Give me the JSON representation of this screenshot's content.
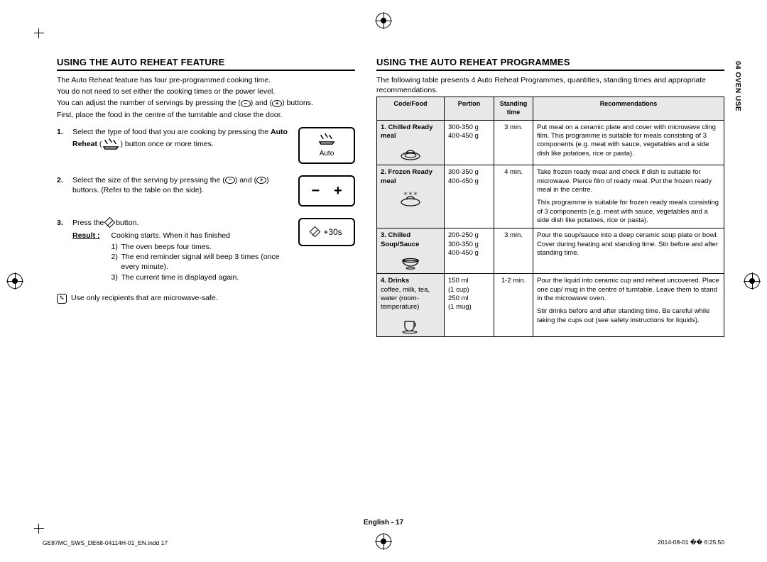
{
  "side_tab": "04  OVEN USE",
  "left": {
    "heading": "USING THE AUTO REHEAT FEATURE",
    "intro": [
      "The Auto Reheat feature has four pre-programmed cooking time.",
      "You do not need to set either the cooking times or the power level.",
      "You can adjust the number of servings by pressing the (−) and (+) buttons.",
      "First, place the food in the centre of the turntable and close the door."
    ],
    "steps": {
      "s1": {
        "text_a": "Select the type of food that you are cooking by pressing the ",
        "bold": "Auto Reheat",
        "text_b": " (",
        "icon_label": "steam",
        "text_c": ") button once or more times.",
        "box_label": "Auto"
      },
      "s2": {
        "text_a": "Select the size of the serving by pressing the (−) and (+) buttons. (Refer to the table on the side)."
      },
      "s3": {
        "text_a": "Press the ",
        "text_b": " button.",
        "result_label": "Result :",
        "result_lead": "Cooking starts. When it has finished",
        "sub": [
          {
            "n": "1)",
            "t": "The oven beeps four times."
          },
          {
            "n": "2)",
            "t": "The end reminder signal will beep 3 times (once every minute)."
          },
          {
            "n": "3)",
            "t": "The current time is displayed again."
          }
        ],
        "box_label": "+30s"
      }
    },
    "note": "Use only recipients that are microwave-safe."
  },
  "right": {
    "heading": "USING THE AUTO REHEAT PROGRAMMES",
    "intro": "The following table presents 4 Auto Reheat Programmes, quantities, standing times and appropriate recommendations.",
    "headers": {
      "code": "Code/Food",
      "portion": "Portion",
      "stand": "Standing time",
      "reco": "Recommendations"
    },
    "rows": [
      {
        "code_title": "1. Chilled Ready meal",
        "icon": "plate",
        "portion": "300-350 g\n400-450 g",
        "stand": "3 min.",
        "reco": [
          "Put meal on a ceramic plate and cover with microwave cling film. This programme is suitable for meals consisting of 3 components (e.g. meat with sauce, vegetables and a side dish like potatoes, rice or pasta)."
        ]
      },
      {
        "code_title": "2. Frozen Ready meal",
        "icon": "frozen",
        "portion": "300-350 g\n400-450 g",
        "stand": "4 min.",
        "reco": [
          "Take frozen ready meal and check if dish is suitable for microwave. Pierce film of ready meal. Put the frozen ready meal in the centre.",
          "This programme is suitable for frozen ready meals consisting of 3 components (e.g. meat with sauce, vegetables and a side dish like potatoes, rice or pasta)."
        ]
      },
      {
        "code_title": "3. Chilled Soup/Sauce",
        "icon": "bowl",
        "portion": "200-250 g\n300-350 g\n400-450 g",
        "stand": "3 min.",
        "reco": [
          "Pour the soup/sauce into a deep ceramic soup plate or bowl. Cover during heating and standing time. Stir before and after standing time."
        ]
      },
      {
        "code_title": "4. Drinks",
        "code_sub": "coffee, milk, tea, water (room-temperature)",
        "icon": "cup",
        "portion": "150 ml\n(1 cup)\n250 ml\n(1 mug)",
        "stand": "1-2 min.",
        "reco": [
          "Pour the liquid into ceramic cup and reheat uncovered. Place one cup/ mug in the centre of turntable. Leave them to stand in the microwave oven.",
          "Stir drinks before and after standing time. Be careful while taking the cups out (see safety instructions for liquids)."
        ]
      }
    ]
  },
  "footer": {
    "center_lang": "English",
    "center_page": "17",
    "left": "GE87MC_SWS_DE68-04114H-01_EN.indd   17",
    "right": "2014-08-01   �� 6:25:50"
  }
}
